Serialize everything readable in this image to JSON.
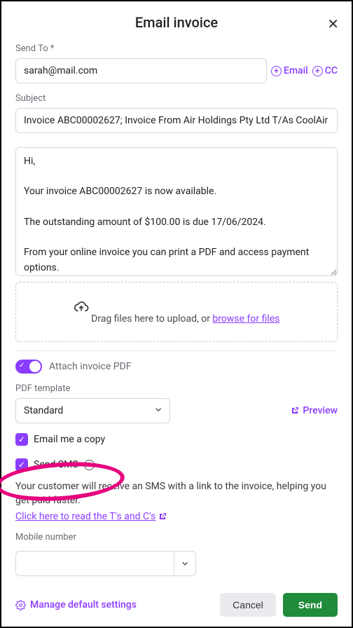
{
  "header": {
    "title": "Email invoice"
  },
  "sendTo": {
    "label": "Send To *",
    "value": "sarah@mail.com",
    "addEmail": "Email",
    "addCC": "CC"
  },
  "subject": {
    "label": "Subject",
    "value": "Invoice ABC00002627; Invoice From Air Holdings Pty Ltd T/As CoolAir"
  },
  "body": {
    "value": "Hi,\n\nYour invoice ABC00002627 is now available.\n\nThe outstanding amount of $100.00 is due 17/06/2024.\n\nFrom your online invoice you can print a PDF and access payment options.\n\nThanks again for trusting Better Builds SMEP. Feel free to contact us if you have any questions"
  },
  "dropzone": {
    "text": "Drag files here to upload, or  ",
    "browse": "browse for files"
  },
  "attachToggle": {
    "label": "Attach invoice PDF",
    "on": true
  },
  "pdfTemplate": {
    "label": "PDF template",
    "value": "Standard",
    "preview": "Preview"
  },
  "emailCopy": {
    "label": "Email me a copy",
    "checked": true
  },
  "sendSms": {
    "label": "Send SMS",
    "checked": true,
    "desc": "Your customer will receive an SMS with a link to the invoice, helping you get paid faster.",
    "tcLink": "Click here to read the T's and C's"
  },
  "mobile": {
    "label": "Mobile number",
    "value": ""
  },
  "footer": {
    "manage": "Manage default settings",
    "cancel": "Cancel",
    "send": "Send"
  }
}
